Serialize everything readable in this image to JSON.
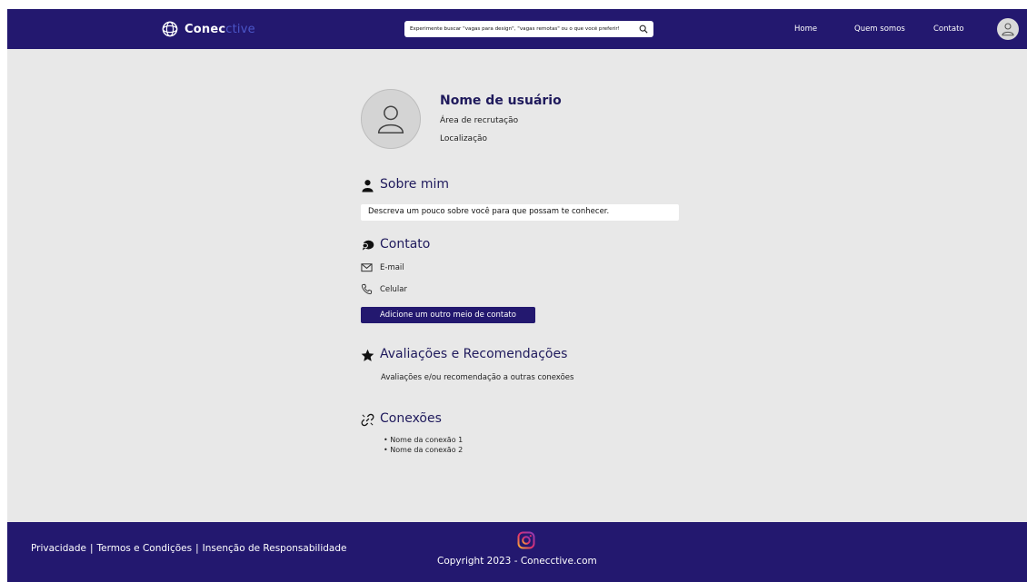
{
  "header": {
    "logo": {
      "text_bold": "Conec",
      "text_dim": "ctive",
      "icon": "globe-icon"
    },
    "search": {
      "placeholder": "Experimente buscar \"vagas para design\", \"vagas remotas\" ou o que você preferir!",
      "icon": "search-icon"
    },
    "nav": {
      "home": "Home",
      "quem_somos": "Quem somos",
      "contato": "Contato"
    },
    "avatar_icon": "user-icon"
  },
  "profile": {
    "name": "Nome de usuário",
    "area": "Área de recrutação",
    "location": "Localização"
  },
  "about": {
    "title": "Sobre mim",
    "icon": "person-icon",
    "placeholder": "Descreva um pouco sobre você para que possam te conhecer."
  },
  "contact": {
    "title": "Contato",
    "icon": "chat-bubbles-icon",
    "email_label": "E-mail",
    "phone_label": "Celular",
    "add_button": "Adicione um outro meio de contato"
  },
  "reviews": {
    "title": "Avaliações e Recomendações",
    "icon": "star-icon",
    "description": "Avaliações e/ou recomendação a outras conexões"
  },
  "connections": {
    "title": "Conexões",
    "icon": "link-icon",
    "items": [
      "Nome da conexão 1",
      "Nome da conexão 2"
    ]
  },
  "footer": {
    "privacy": "Privacidade",
    "terms": "Termos e Condições",
    "disclaimer": "Insenção de Responsabilidade",
    "separator": "|",
    "copyright": "Copyright 2023 - Conecctive.com",
    "social_icon": "instagram-icon"
  },
  "colors": {
    "brand": "#23186f",
    "background": "#e8e8e8",
    "title_text": "#1f1a5c"
  }
}
